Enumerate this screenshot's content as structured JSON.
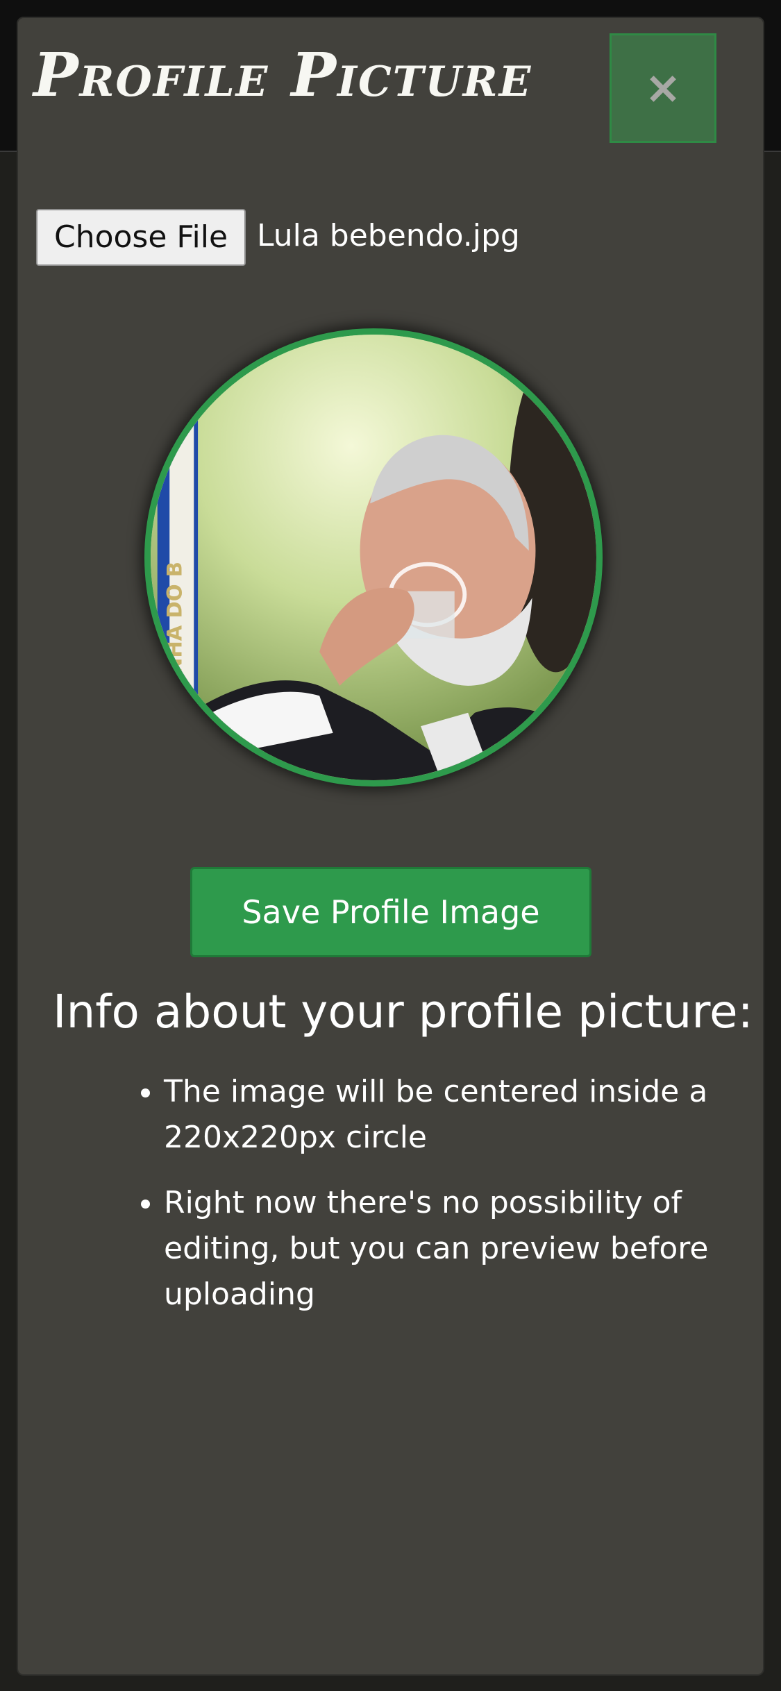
{
  "modal": {
    "title": "Profile Picture",
    "close_label": "×"
  },
  "file_input": {
    "button_label": "Choose File",
    "file_name": "Lula bebendo.jpg"
  },
  "preview": {
    "alt": "Profile picture preview",
    "banner_text": "NHA DO B"
  },
  "save_button_label": "Save Profile Image",
  "info": {
    "heading": "Info about your profile picture:",
    "items": [
      "The image will be centered inside a 220x220px circle",
      "Right now there's no possibility of editing, but you can preview before uploading"
    ]
  },
  "colors": {
    "accent": "#2e9a4c",
    "modal_bg": "#42413c",
    "close_bg": "#3e7046"
  }
}
